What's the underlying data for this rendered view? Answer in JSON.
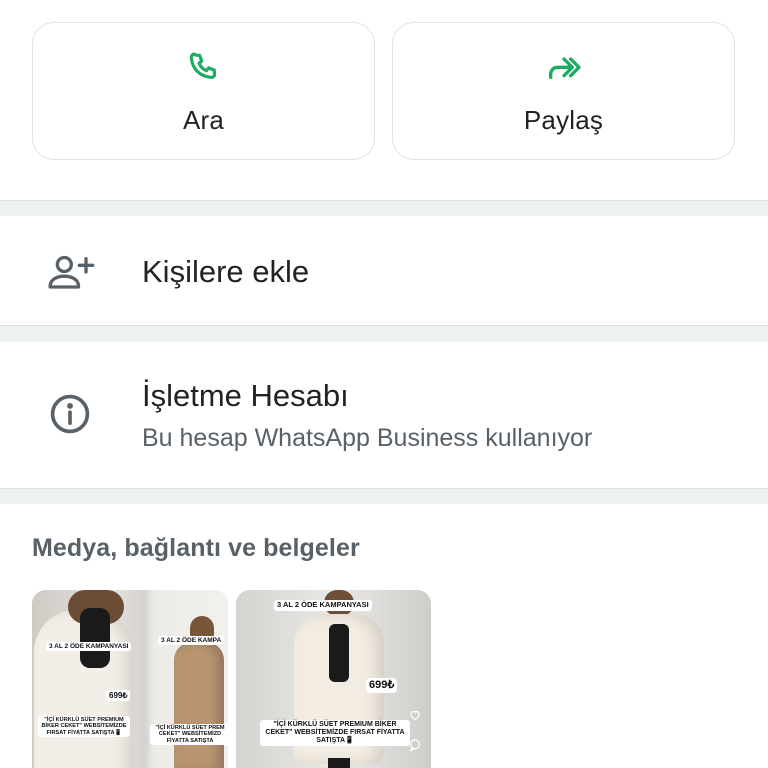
{
  "actions": {
    "call_label": "Ara",
    "share_label": "Paylaş"
  },
  "contacts_row": {
    "label": "Kişilere ekle"
  },
  "business_row": {
    "title": "İşletme Hesabı",
    "subtitle": "Bu hesap WhatsApp Business kullanıyor"
  },
  "media": {
    "heading": "Medya, bağlantı ve belgeler",
    "items": [
      {
        "campaign": "3 AL 2 ÖDE KAMPANYASI",
        "campaign_partial": "3 AL 2 ÖDE KAMPA",
        "price": "699₺",
        "caption": "\"İÇİ KÜRKLÜ SÜET PREMIUM BİKER CEKET\" WEBSİTEMİZDE FIRSAT FİYATTA SATIŞTA📱",
        "caption_partial": "\"İÇİ KÜRKLÜ SÜET PREM CEKET\" WEBSİTEMİZD FİYATTA SATIŞTA"
      },
      {
        "campaign": "3 AL 2 ÖDE KAMPANYASI",
        "price": "699₺",
        "caption": "\"İÇİ KÜRKLÜ SÜET PREMIUM BİKER CEKET\" WEBSİTEMİZDE FIRSAT FİYATTA SATIŞTA📱"
      }
    ]
  },
  "colors": {
    "accent": "#1daa61",
    "primary_text": "#1f2326",
    "secondary_text": "#596168",
    "divider": "#eef1f2"
  },
  "icons": {
    "call": "phone-icon",
    "share": "forward-icon",
    "add_contact": "add-person-icon",
    "business": "info-icon"
  }
}
